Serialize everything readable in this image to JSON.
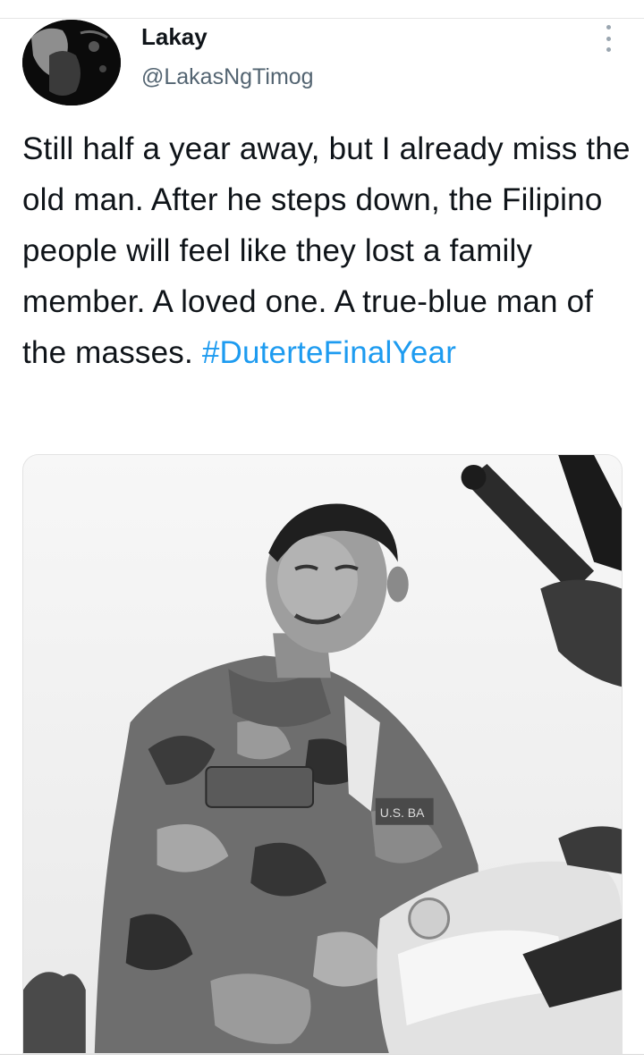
{
  "tweet": {
    "display_name": "Lakay",
    "handle": "@LakasNgTimog",
    "text_main": "Still half a year away, but I already miss the old man. After he steps down, the Filipino people will feel like they lost a family member. A loved one. A true-blue man of the masses. ",
    "hashtag": "#DuterteFinalYear",
    "more_icon": "more-vertical-icon"
  },
  "media": {
    "patch_text": "U.S. BA"
  },
  "colors": {
    "hashtag": "#1d9bf0",
    "handle": "#536471",
    "text": "#0f1419"
  }
}
